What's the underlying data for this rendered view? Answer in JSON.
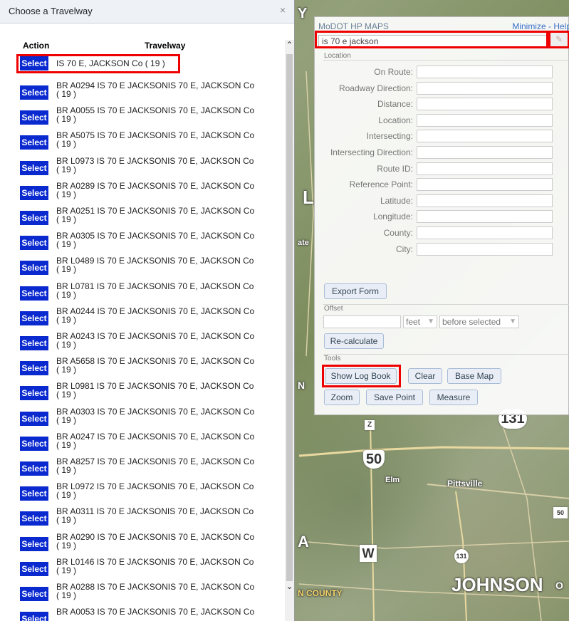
{
  "dialog": {
    "title": "Choose a Travelway",
    "close_icon": "close-icon",
    "columns": {
      "action": "Action",
      "travelway": "Travelway"
    },
    "select_label": "Select",
    "rows": [
      {
        "line1": "IS 70 E, JACKSON Co ( 19 )",
        "line2": ""
      },
      {
        "line1": "BR A0294 IS 70 E JACKSONIS 70 E, JACKSON Co",
        "line2": "( 19 )"
      },
      {
        "line1": "BR A0055 IS 70 E JACKSONIS 70 E, JACKSON Co",
        "line2": "( 19 )"
      },
      {
        "line1": "BR A5075 IS 70 E JACKSONIS 70 E, JACKSON Co",
        "line2": "( 19 )"
      },
      {
        "line1": "BR L0973 IS 70 E JACKSONIS 70 E, JACKSON Co",
        "line2": "( 19 )"
      },
      {
        "line1": "BR A0289 IS 70 E JACKSONIS 70 E, JACKSON Co",
        "line2": "( 19 )"
      },
      {
        "line1": "BR A0251 IS 70 E JACKSONIS 70 E, JACKSON Co",
        "line2": "( 19 )"
      },
      {
        "line1": "BR A0305 IS 70 E JACKSONIS 70 E, JACKSON Co",
        "line2": "( 19 )"
      },
      {
        "line1": "BR L0489 IS 70 E JACKSONIS 70 E, JACKSON Co",
        "line2": "( 19 )"
      },
      {
        "line1": "BR L0781 IS 70 E JACKSONIS 70 E, JACKSON Co",
        "line2": "( 19 )"
      },
      {
        "line1": "BR A0244 IS 70 E JACKSONIS 70 E, JACKSON Co",
        "line2": "( 19 )"
      },
      {
        "line1": "BR A0243 IS 70 E JACKSONIS 70 E, JACKSON Co",
        "line2": "( 19 )"
      },
      {
        "line1": "BR A5658 IS 70 E JACKSONIS 70 E, JACKSON Co",
        "line2": "( 19 )"
      },
      {
        "line1": "BR L0981 IS 70 E JACKSONIS 70 E, JACKSON Co",
        "line2": "( 19 )"
      },
      {
        "line1": "BR A0303 IS 70 E JACKSONIS 70 E, JACKSON Co",
        "line2": "( 19 )"
      },
      {
        "line1": "BR A0247 IS 70 E JACKSONIS 70 E, JACKSON Co",
        "line2": "( 19 )"
      },
      {
        "line1": "BR A8257 IS 70 E JACKSONIS 70 E, JACKSON Co",
        "line2": "( 19 )"
      },
      {
        "line1": "BR L0972 IS 70 E JACKSONIS 70 E, JACKSON Co",
        "line2": "( 19 )"
      },
      {
        "line1": "BR A0311 IS 70 E JACKSONIS 70 E, JACKSON Co",
        "line2": "( 19 )"
      },
      {
        "line1": "BR A0290 IS 70 E JACKSONIS 70 E, JACKSON Co",
        "line2": "( 19 )"
      },
      {
        "line1": "BR L0146 IS 70 E JACKSONIS 70 E, JACKSON Co",
        "line2": "( 19 )"
      },
      {
        "line1": "BR A0288 IS 70 E JACKSONIS 70 E, JACKSON Co",
        "line2": "( 19 )"
      },
      {
        "line1": "BR A0053 IS 70 E JACKSONIS 70 E, JACKSON Co",
        "line2": ""
      }
    ]
  },
  "panel": {
    "title": "MoDOT HP MAPS",
    "links": "Minimize - Help",
    "search_value": "is 70 e jackson",
    "search_icon": "locate-icon",
    "location_section": "Location",
    "fields": [
      "On Route:",
      "Roadway Direction:",
      "Distance:",
      "Location:",
      "Intersecting:",
      "Intersecting Direction:",
      "Route ID:",
      "Reference Point:",
      "Latitude:",
      "Longitude:",
      "County:",
      "City:"
    ],
    "export_button": "Export Form",
    "offset_section": "Offset",
    "offset_unit": "feet",
    "offset_position": "before selected",
    "recalc_button": "Re-calculate",
    "tools_section": "Tools",
    "tools": {
      "show_log_book": "Show Log Book",
      "clear": "Clear",
      "base_map": "Base Map",
      "zoom": "Zoom",
      "save_point": "Save Point",
      "measure": "Measure"
    }
  },
  "map": {
    "labels": {
      "johnson": "JOHNSON",
      "county": "N COUNTY",
      "pittsville": "Pittsville",
      "elm": "Elm"
    },
    "shields": {
      "r131_top": "131",
      "r50": "50",
      "z": "Z",
      "w": "W",
      "r131_small": "131",
      "r50_small": "50"
    },
    "partial_labels": {
      "top_y": "Y",
      "l": "L",
      "a": "A",
      "n": "N",
      "ate": "ate",
      "o": "O",
      "j": "J"
    }
  }
}
